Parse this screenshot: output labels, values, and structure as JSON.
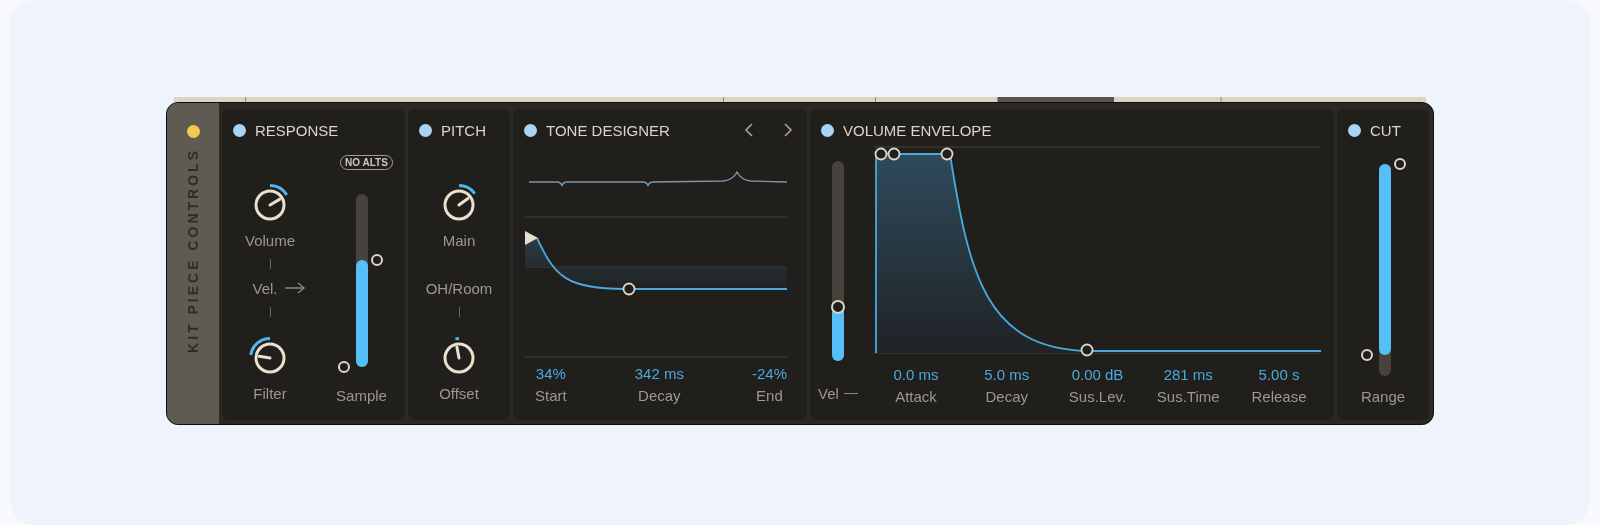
{
  "side_panel": {
    "title": "KIT PIECE CONTROLS",
    "active": true
  },
  "sections": [
    {
      "kind": "response",
      "title": "RESPONSE",
      "enabled": true,
      "badge": "NO ALTS",
      "knobs": [
        {
          "label": "Volume",
          "level": 0.72
        },
        {
          "label": "Filter",
          "level": 0.2
        }
      ],
      "middle_label": "Vel.",
      "slider": {
        "label": "Sample",
        "handles": [
          {
            "level": 0.0
          },
          {
            "level": 0.62
          }
        ]
      }
    },
    {
      "kind": "pitch",
      "title": "PITCH",
      "enabled": true,
      "knobs": [
        {
          "label": "Main",
          "level": 0.7
        },
        {
          "label": "Offset",
          "level": 0.46
        }
      ],
      "middle_label": "OH/Room"
    },
    {
      "kind": "tone",
      "title": "TONE DESIGNER",
      "enabled": true,
      "params": [
        {
          "value": "34%",
          "label": "Start"
        },
        {
          "value": "342 ms",
          "label": "Decay"
        },
        {
          "value": "-24%",
          "label": "End"
        }
      ]
    },
    {
      "kind": "envelope",
      "title": "VOLUME ENVELOPE",
      "enabled": true,
      "velocity": {
        "label": "Vel",
        "level": 0.27
      },
      "params": [
        {
          "value": "0.0 ms",
          "label": "Attack"
        },
        {
          "value": "5.0 ms",
          "label": "Decay"
        },
        {
          "value": "0.00 dB",
          "label": "Sus.Lev."
        },
        {
          "value": "281 ms",
          "label": "Sus.Time"
        },
        {
          "value": "5.00 s",
          "label": "Release"
        }
      ]
    },
    {
      "kind": "cut",
      "title": "CUT",
      "enabled": true,
      "slider": {
        "label": "Range",
        "handles": [
          {
            "level": 0.1
          },
          {
            "level": 1.0
          }
        ]
      }
    }
  ]
}
